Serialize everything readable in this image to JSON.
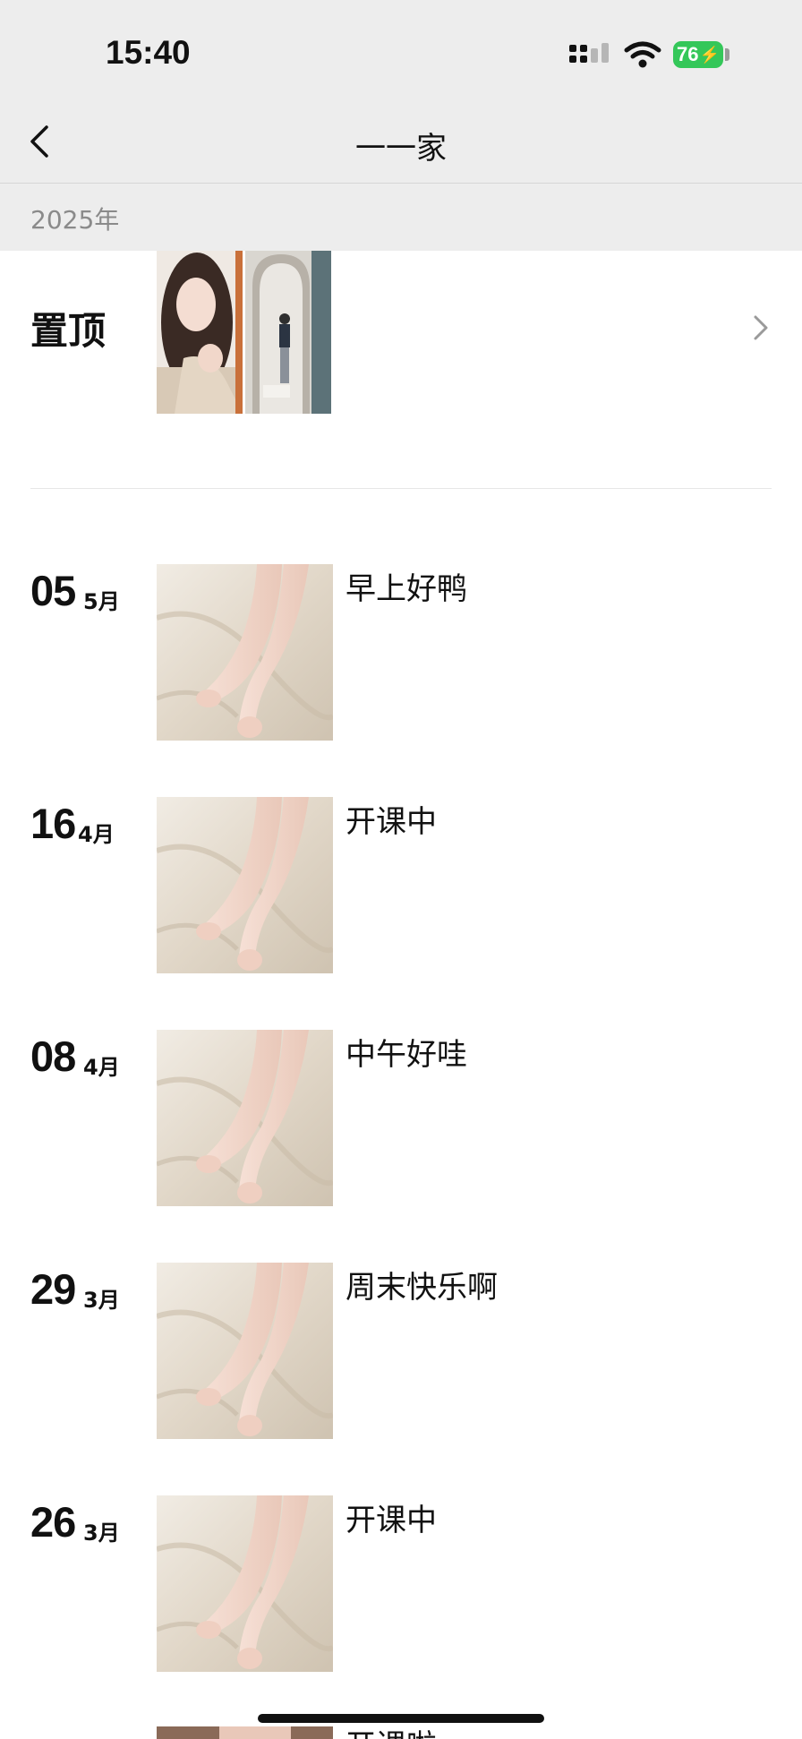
{
  "status_bar": {
    "time": "15:40",
    "battery_level": "76",
    "signal_icon": "cellular-signal-icon",
    "wifi_icon": "wifi-icon",
    "battery_color": "#34c759"
  },
  "nav": {
    "back_icon": "chevron-left-icon",
    "title": "一一家"
  },
  "year_label": "2025年",
  "pinned": {
    "label": "置顶",
    "chevron_icon": "chevron-right-icon",
    "thumbnails": [
      "portrait photo",
      "mirror selfie photo"
    ]
  },
  "posts": [
    {
      "day": "05",
      "month": "5月",
      "text": "早上好鸭"
    },
    {
      "day": "16",
      "month": "4月",
      "text": "开课中"
    },
    {
      "day": "08",
      "month": "4月",
      "text": "中午好哇"
    },
    {
      "day": "29",
      "month": "3月",
      "text": "周末快乐啊"
    },
    {
      "day": "26",
      "month": "3月",
      "text": "开课中"
    },
    {
      "day": "",
      "month": "",
      "text": "开课啦"
    }
  ],
  "colors": {
    "header_bg": "#ededed",
    "year_label": "#8a8a8a"
  }
}
